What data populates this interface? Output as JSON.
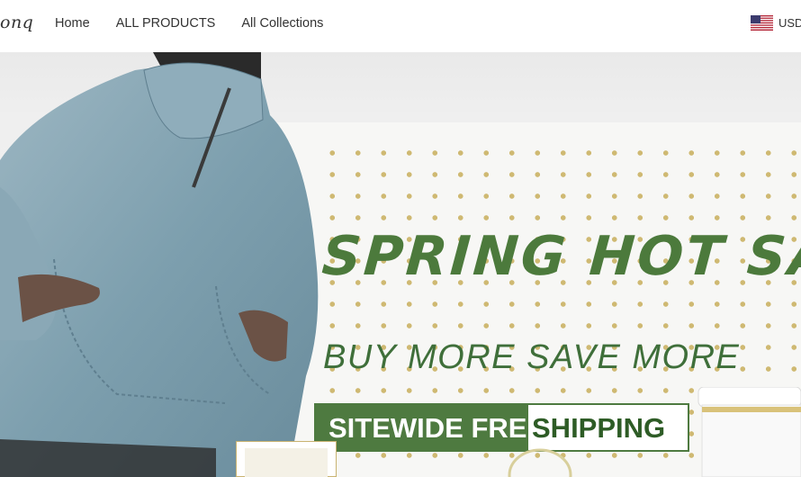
{
  "header": {
    "logo_text": "onq",
    "nav": [
      {
        "label": "Home"
      },
      {
        "label": "ALL PRODUCTS"
      },
      {
        "label": "All Collections"
      }
    ],
    "currency": {
      "code": "USD",
      "flag_icon": "us-flag-icon"
    }
  },
  "banner": {
    "headline": "SPRING HOT SA",
    "subheadline": "BUY MORE SAVE MORE",
    "shipping_part1": "SITEWIDE FREE",
    "shipping_part2": "SHIPPING"
  },
  "colors": {
    "green": "#4c7a3c",
    "dot_gold": "#cfb972",
    "denim": "#7d9fae"
  }
}
